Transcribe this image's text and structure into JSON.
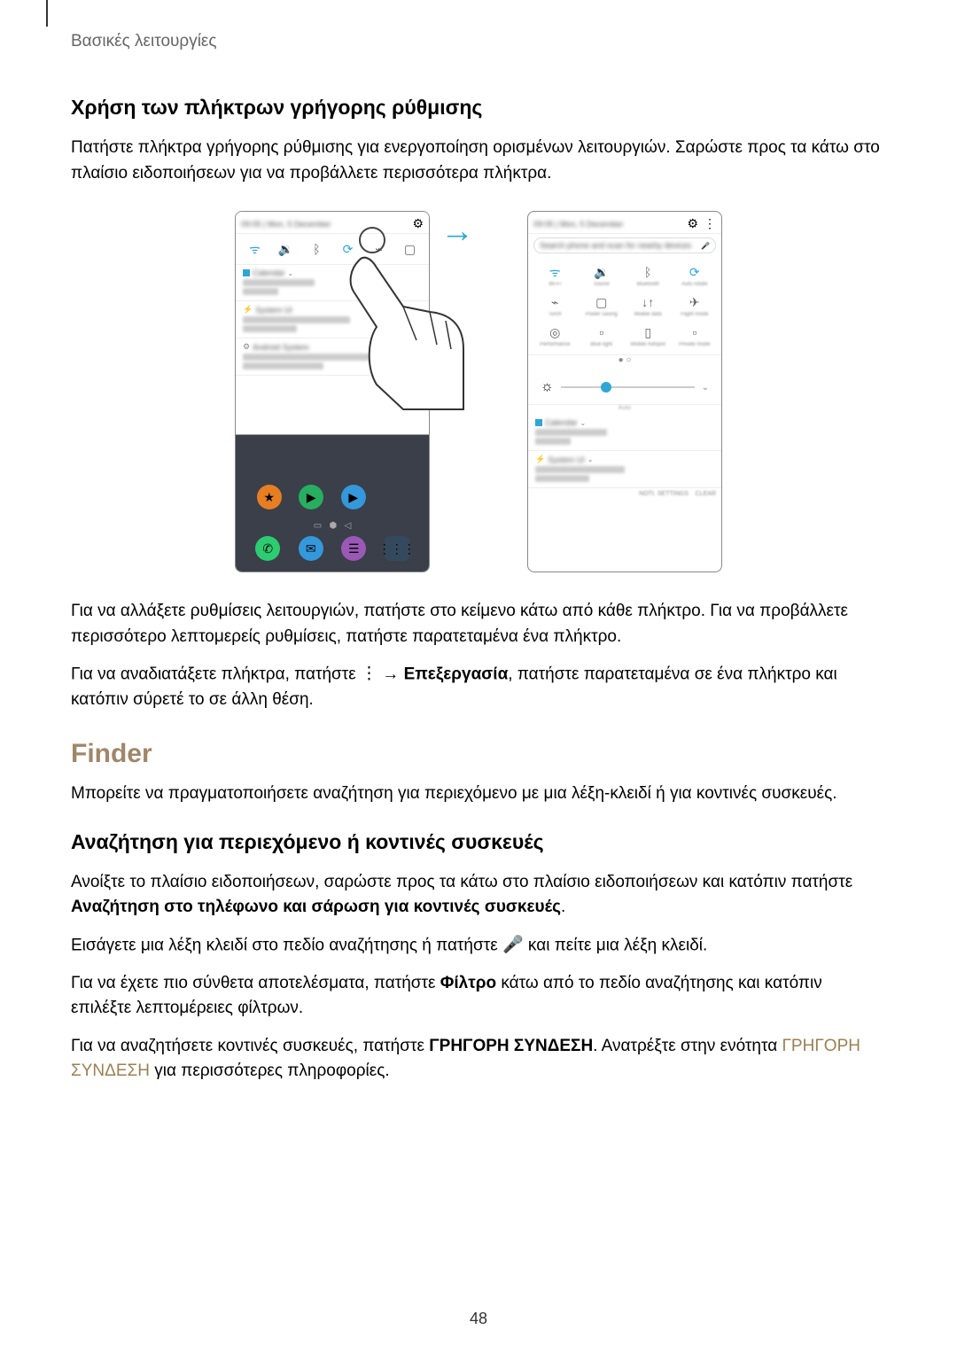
{
  "breadcrumb": "Βασικές λειτουργίες",
  "section1_heading": "Χρήση των πλήκτρων γρήγορης ρύθμισης",
  "section1_para1": "Πατήστε πλήκτρα γρήγορης ρύθμισης για ενεργοποίηση ορισμένων λειτουργιών. Σαρώστε προς τα κάτω στο πλαίσιο ειδοποιήσεων για να προβάλλετε περισσότερα πλήκτρα.",
  "section1_para2": "Για να αλλάξετε ρυθμίσεις λειτουργιών, πατήστε στο κείμενο κάτω από κάθε πλήκτρο. Για να προβάλλετε περισσότερο λεπτομερείς ρυθμίσεις, πατήστε παρατεταμένα ένα πλήκτρο.",
  "section1_para3_a": "Για να αναδιατάξετε πλήκτρα, πατήστε ",
  "section1_para3_arrow": " → ",
  "section1_para3_bold": "Επεξεργασία",
  "section1_para3_b": ", πατήστε παρατεταμένα σε ένα πλήκτρο και κατόπιν σύρετέ το σε άλλη θέση.",
  "finder_heading": "Finder",
  "finder_para1": "Μπορείτε να πραγματοποιήσετε αναζήτηση για περιεχόμενο με μια λέξη-κλειδί ή για κοντινές συσκευές.",
  "section2_heading": "Αναζήτηση για περιεχόμενο ή κοντινές συσκευές",
  "section2_para1_a": "Ανοίξτε το πλαίσιο ειδοποιήσεων, σαρώστε προς τα κάτω στο πλαίσιο ειδοποιήσεων και κατόπιν πατήστε ",
  "section2_para1_bold": "Αναζήτηση στο τηλέφωνο και σάρωση για κοντινές συσκευές",
  "section2_para1_b": ".",
  "section2_para2_a": "Εισάγετε μια λέξη κλειδί στο πεδίο αναζήτησης ή πατήστε ",
  "section2_para2_b": " και πείτε μια λέξη κλειδί.",
  "section2_para3_a": "Για να έχετε πιο σύνθετα αποτελέσματα, πατήστε ",
  "section2_para3_bold": "Φίλτρο",
  "section2_para3_b": " κάτω από το πεδίο αναζήτησης και κατόπιν επιλέξτε λεπτομέρειες φίλτρων.",
  "section2_para4_a": "Για να αναζητήσετε κοντινές συσκευές, πατήστε ",
  "section2_para4_bold": "ΓΡΗΓΟΡΗ ΣΥΝΔΕΣΗ",
  "section2_para4_b": ". Ανατρέξτε στην ενότητα ",
  "section2_para4_link": "ΓΡΗΓΟΡΗ ΣΥΝΔΕΣΗ",
  "section2_para4_c": " για περισσότερες πληροφορίες.",
  "page_number": "48",
  "icons": {
    "gear": "⚙",
    "more": "⋮",
    "wifi": "ᯤ",
    "sound": "🔉",
    "bt": "ᛒ",
    "rotate": "⟳",
    "flashlight": "⌁",
    "sim": "▢",
    "swap": "↓↑",
    "airplane": "✈",
    "location": "◎",
    "doc1": "▫",
    "doc2": "▯",
    "doc3": "▫",
    "brightness": "☼",
    "chev_down": "⌄",
    "mic_inline": "🎤",
    "more_inline": "⋮",
    "arrow_right": "→"
  }
}
